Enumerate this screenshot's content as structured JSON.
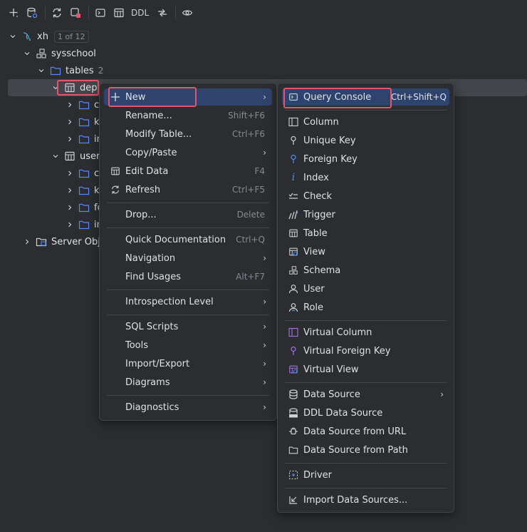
{
  "toolbar": {
    "buttons": [
      "add-icon",
      "datasource-properties-icon",
      "refresh-icon",
      "disconnect-icon",
      "console-icon",
      "table-view-icon",
      "ddl-text",
      "diff-icon",
      "eye-icon"
    ],
    "ddl_label": "DDL"
  },
  "tree": {
    "root": {
      "label": "xh",
      "badge": "1 of 12"
    },
    "schema": {
      "label": "sysschool"
    },
    "tables": {
      "label": "tables",
      "count": "2"
    },
    "dept": {
      "label": "dept"
    },
    "dept_children": [
      "co",
      "ke",
      "in"
    ],
    "user": {
      "label": "user"
    },
    "user_children": [
      "co",
      "ke",
      "fo",
      "in"
    ],
    "server_objects": {
      "label": "Server Obje"
    }
  },
  "context_menu": {
    "new": {
      "label": "New"
    },
    "rename": {
      "label": "Rename...",
      "shortcut": "Shift+F6"
    },
    "modify_table": {
      "label": "Modify Table...",
      "shortcut": "Ctrl+F6"
    },
    "copy_paste": {
      "label": "Copy/Paste"
    },
    "edit_data": {
      "label": "Edit Data",
      "shortcut": "F4"
    },
    "refresh": {
      "label": "Refresh",
      "shortcut": "Ctrl+F5"
    },
    "drop": {
      "label": "Drop...",
      "shortcut": "Delete"
    },
    "quick_doc": {
      "label": "Quick Documentation",
      "shortcut": "Ctrl+Q"
    },
    "navigation": {
      "label": "Navigation"
    },
    "find_usages": {
      "label": "Find Usages",
      "shortcut": "Alt+F7"
    },
    "introspection": {
      "label": "Introspection Level"
    },
    "sql_scripts": {
      "label": "SQL Scripts"
    },
    "tools": {
      "label": "Tools"
    },
    "import_export": {
      "label": "Import/Export"
    },
    "diagrams": {
      "label": "Diagrams"
    },
    "diagnostics": {
      "label": "Diagnostics"
    }
  },
  "new_submenu": {
    "query_console": {
      "label": "Query Console",
      "shortcut": "Ctrl+Shift+Q"
    },
    "column": "Column",
    "unique_key": "Unique Key",
    "foreign_key": "Foreign Key",
    "index": "Index",
    "check": "Check",
    "trigger": "Trigger",
    "table": "Table",
    "view": "View",
    "schema": "Schema",
    "user": "User",
    "role": "Role",
    "virtual_column": "Virtual Column",
    "virtual_foreign_key": "Virtual Foreign Key",
    "virtual_view": "Virtual View",
    "data_source": "Data Source",
    "ddl_data_source": "DDL Data Source",
    "data_source_url": "Data Source from URL",
    "data_source_path": "Data Source from Path",
    "driver": "Driver",
    "import_data_sources": "Import Data Sources..."
  },
  "colors": {
    "background": "#2b2d30",
    "selection": "#2e436e",
    "highlight_box": "#e0566a",
    "folder_icon": "#548af7",
    "accent_purple": "#a571e6"
  }
}
